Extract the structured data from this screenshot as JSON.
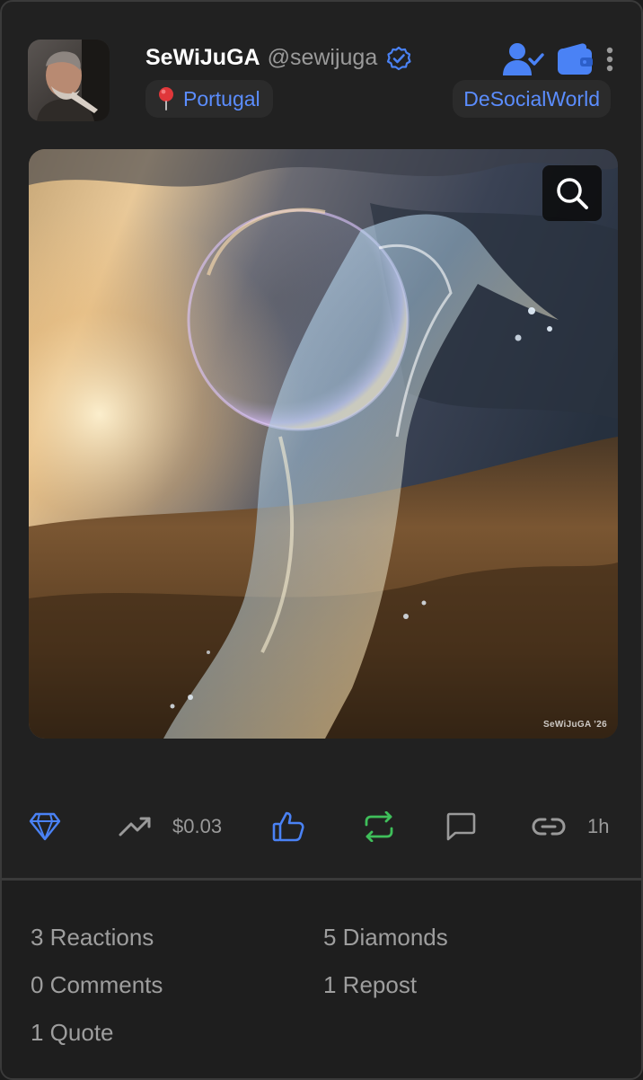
{
  "author": {
    "display_name": "SeWiJuGA",
    "handle": "@sewijuga",
    "location": "Portugal",
    "community": "DeSocialWorld"
  },
  "icons": {
    "verified": "verified-check-icon",
    "location": "pin-icon",
    "follow": "user-check-icon",
    "wallet": "wallet-icon",
    "more": "more-vertical-icon",
    "zoom": "search-icon",
    "diamond": "diamond-icon",
    "trending": "trending-up-icon",
    "like": "thumbs-up-icon",
    "repost": "repost-icon",
    "comment": "comment-icon",
    "link": "link-icon"
  },
  "image": {
    "watermark": "SeWiJuGA ’26"
  },
  "actions": {
    "value": "$0.03",
    "timestamp": "1h"
  },
  "stats": {
    "reactions": "3 Reactions",
    "diamonds": "5 Diamonds",
    "comments": "0 Comments",
    "reposts": "1 Repost",
    "quotes": "1 Quote"
  },
  "colors": {
    "accent_blue": "#4a82f5",
    "repost_green": "#3fbf5a",
    "background": "#212121",
    "muted_text": "#9e9e9e"
  }
}
